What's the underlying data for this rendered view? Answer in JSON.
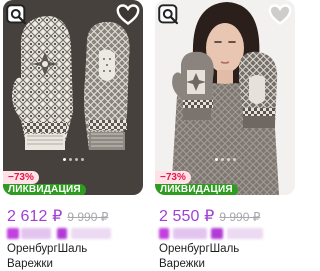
{
  "cards": [
    {
      "discount": "−73%",
      "promo_label": "ЛИКВИДАЦИЯ",
      "price": "2 612 ₽",
      "old_price": "9 990 ₽",
      "brand": "ОренбургШаль",
      "name": "Варежки",
      "image_icons": [
        "image-search-icon",
        "heart-icon"
      ]
    },
    {
      "discount": "−73%",
      "promo_label": "ЛИКВИДАЦИЯ",
      "price": "2 550 ₽",
      "old_price": "9 990 ₽",
      "brand": "ОренбургШаль",
      "name": "Варежки",
      "image_icons": [
        "image-search-icon",
        "heart-icon"
      ]
    }
  ],
  "colors": {
    "price": "#a23fd6",
    "old_price": "#a7a7ad",
    "discount_text": "#e6174a",
    "discount_bg": "#ffe1e6",
    "promo_bg": "#2f9c21"
  }
}
